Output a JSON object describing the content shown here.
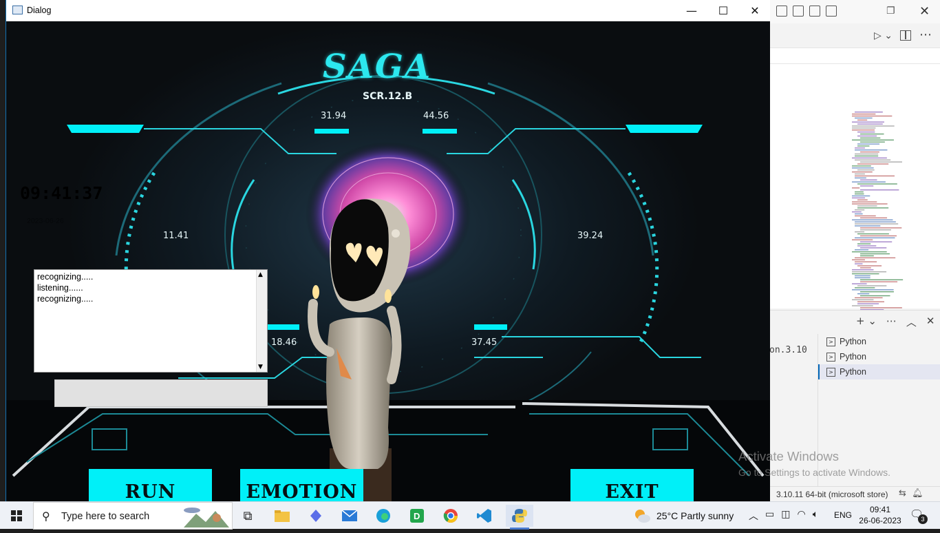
{
  "dialog": {
    "title": "Dialog",
    "controls": {
      "minimize": "—",
      "maximize": "☐",
      "close": "✕"
    },
    "clock": "09:41:37",
    "date": "2023-06-26",
    "hud": {
      "title": "SAGA",
      "subtitle": "SCR.12.B",
      "readouts": [
        "31.94",
        "44.56",
        "11.41",
        "39.24",
        "18.46",
        "37.45"
      ]
    },
    "log_lines": [
      "recognizing.....",
      "listening......",
      "recognizing....."
    ],
    "input_value": "",
    "buttons": {
      "run": "RUN",
      "emotion": "EMOTION",
      "exit": "EXIT"
    }
  },
  "vscode": {
    "terminal_text": "on.3.10",
    "terminals": [
      "Python",
      "Python",
      "Python"
    ],
    "status_python": "3.10.11 64-bit (microsoft store)"
  },
  "watermark": {
    "line1": "Activate Windows",
    "line2": "Go to Settings to activate Windows."
  },
  "taskbar": {
    "search_placeholder": "Type here to search",
    "weather": "25°C  Partly sunny",
    "lang": "ENG",
    "time": "09:41",
    "date": "26-06-2023",
    "notifications": "3"
  },
  "colors": {
    "accent": "#00f0f8",
    "hud_cyan": "#2ce8ef",
    "hud_bg": "#0a0d10"
  }
}
